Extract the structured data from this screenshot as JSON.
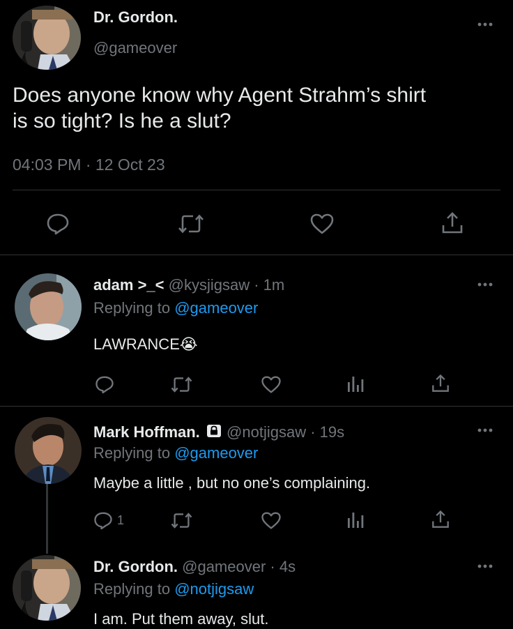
{
  "main_tweet": {
    "display_name": "Dr. Gordon.",
    "handle": "@gameover",
    "text_line1": "Does anyone know why Agent Strahm’s shirt",
    "text_line2": "is so tight? Is he a slut?",
    "timestamp": "04:03 PM · 12 Oct 23"
  },
  "replies": [
    {
      "display_name": "adam >_<",
      "handle": "@kysjigsaw",
      "time": "· 1m",
      "replying_prefix": "Replying to",
      "replying_to": "@gameover",
      "text": "LAWRANCE😭"
    },
    {
      "display_name": "Mark Hoffman.",
      "handle": "@notjigsaw",
      "time": "· 19s",
      "replying_prefix": "Replying to",
      "replying_to": "@gameover",
      "text": "Maybe a little , but no one’s complaining.",
      "reply_count": "1",
      "locked": true
    },
    {
      "display_name": "Dr. Gordon.",
      "handle": "@gameover",
      "time": "· 4s",
      "replying_prefix": "Replying to",
      "replying_to": "@notjigsaw",
      "text": "I am. Put them away, slut."
    }
  ],
  "icons": {
    "more": "more-horizontal-icon",
    "reply": "reply-bubble-icon",
    "retweet": "retweet-icon",
    "like": "heart-icon",
    "share": "share-upload-icon",
    "views": "analytics-bars-icon",
    "lock": "lock-icon"
  },
  "colors": {
    "background": "#000000",
    "text": "#e7e9ea",
    "muted": "#71767b",
    "link": "#1d9bf0",
    "divider": "#2f3336"
  }
}
